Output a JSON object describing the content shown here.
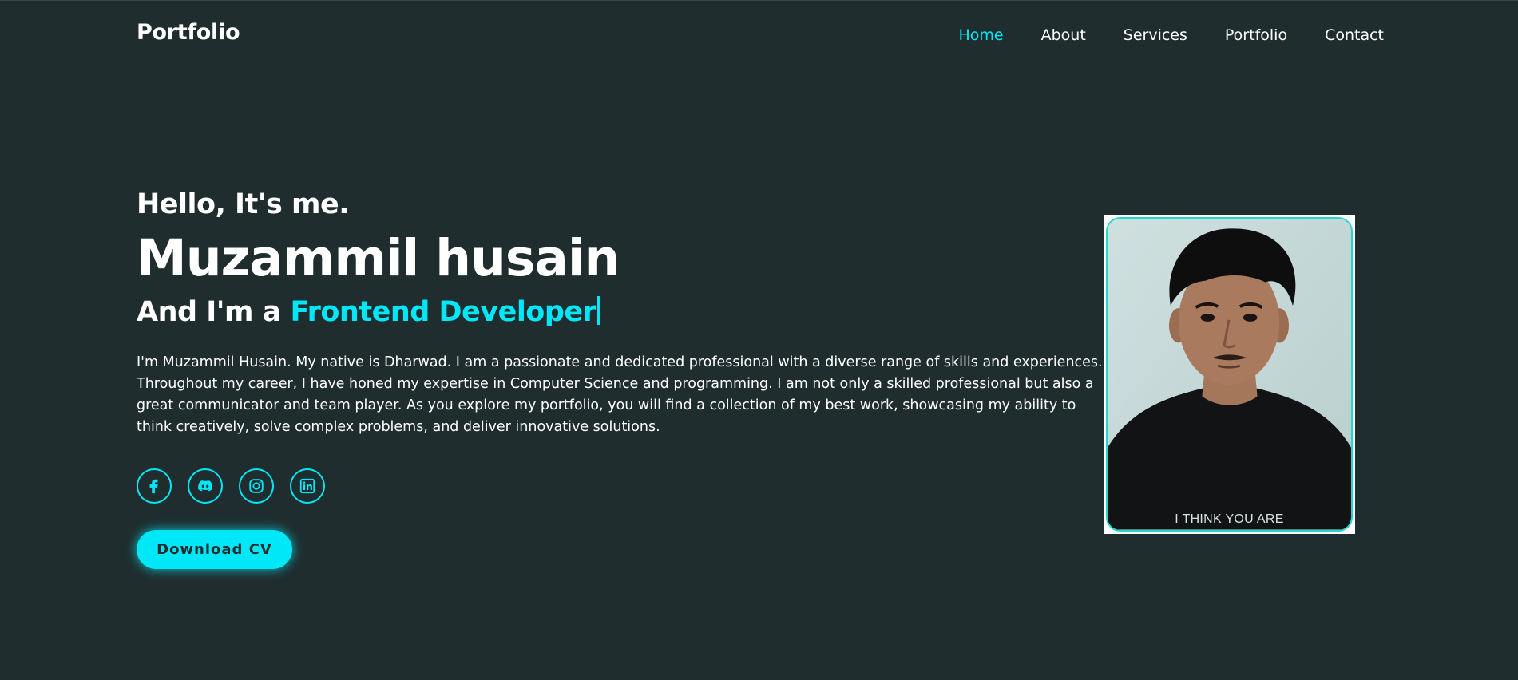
{
  "header": {
    "logo": "Portfolio",
    "nav": [
      {
        "label": "Home",
        "active": true
      },
      {
        "label": "About",
        "active": false
      },
      {
        "label": "Services",
        "active": false
      },
      {
        "label": "Portfolio",
        "active": false
      },
      {
        "label": "Contact",
        "active": false
      }
    ]
  },
  "hero": {
    "greeting": "Hello, It's me.",
    "name": "Muzammil husain",
    "role_prefix": "And I'm a ",
    "role_highlight": "Frontend Developer",
    "bio": "I'm Muzammil Husain. My native is Dharwad. I am a passionate and dedicated professional with a diverse range of skills and experiences. Throughout my career, I have honed my expertise in Computer Science and programming. I am not only a skilled professional but also a great communicator and team player. As you explore my portfolio, you will find a collection of my best work, showcasing my ability to think creatively, solve complex problems, and deliver innovative solutions.",
    "socials": [
      {
        "icon": "facebook-icon"
      },
      {
        "icon": "discord-icon"
      },
      {
        "icon": "instagram-icon"
      },
      {
        "icon": "linkedin-icon"
      }
    ],
    "cv_button": "Download CV",
    "photo_shirt_text": "I THINK YOU ARE"
  },
  "colors": {
    "background": "#1f2d2e",
    "accent": "#00e8f8",
    "text": "#ffffff"
  }
}
